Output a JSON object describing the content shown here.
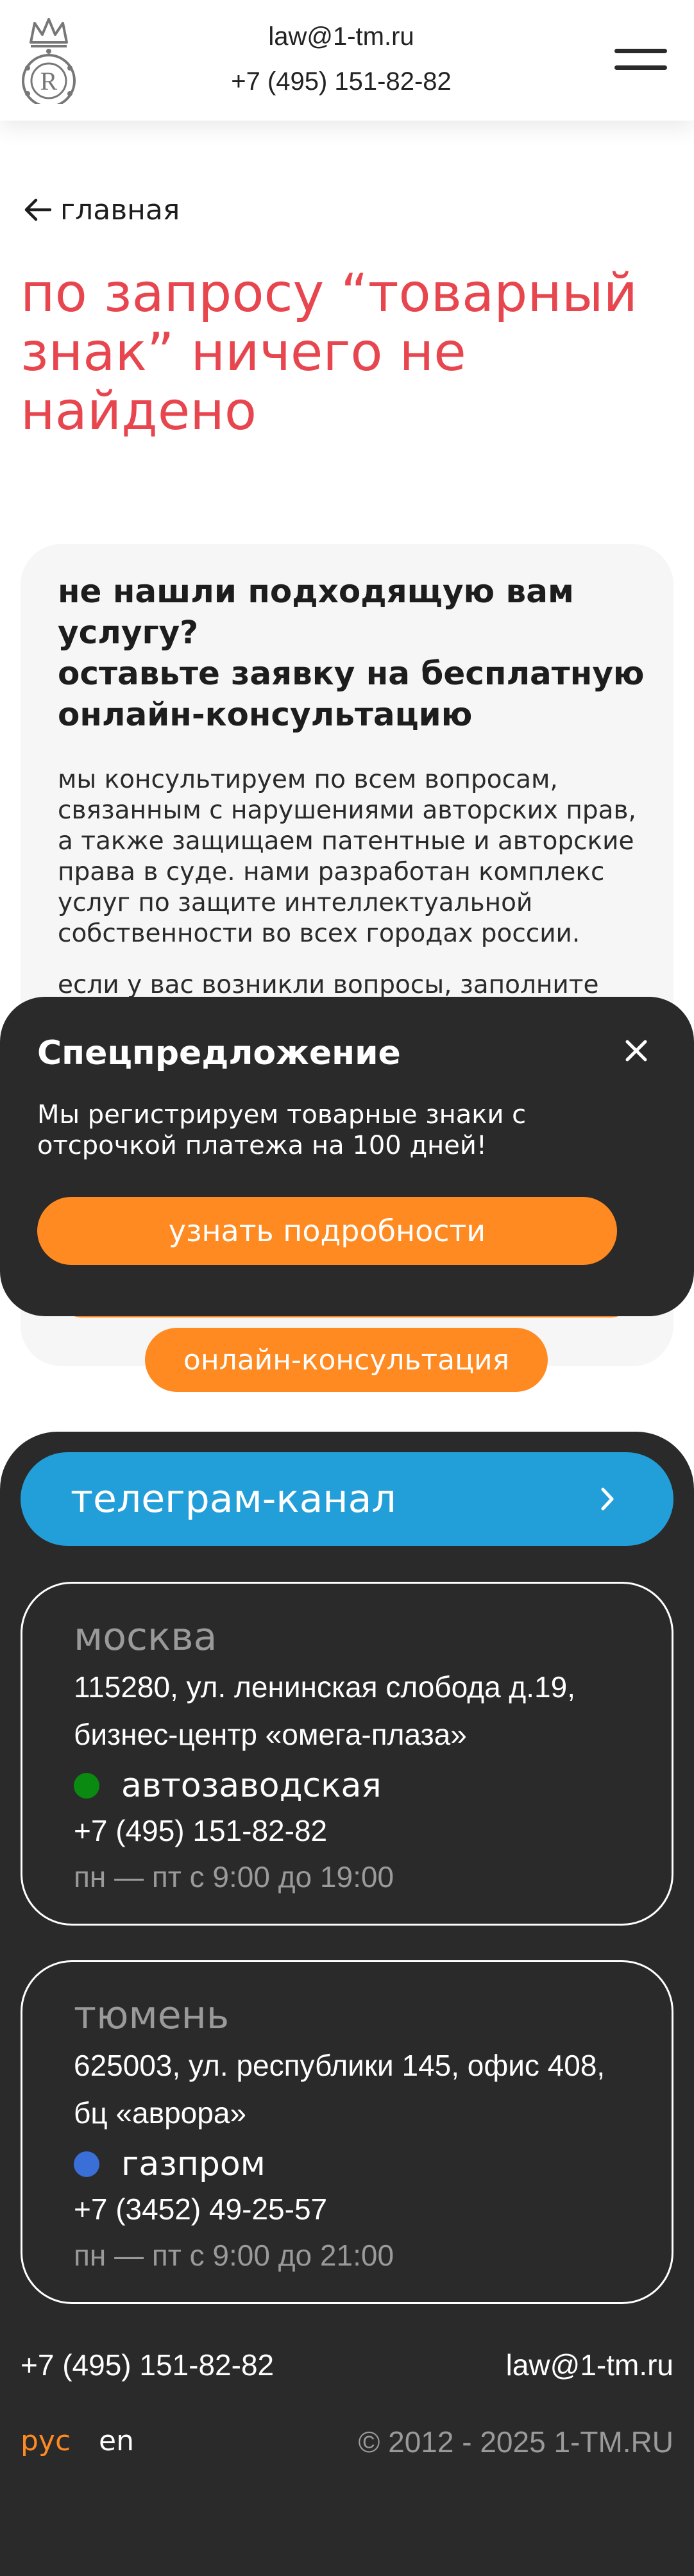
{
  "header": {
    "email": "law@1-tm.ru",
    "phone": "+7 (495) 151-82-82",
    "logo_letter": "R"
  },
  "breadcrumb": {
    "back_label": "главная"
  },
  "page_title": "по запросу “товарный знак” ничего не найдено",
  "consult": {
    "heading": "не нашли подходящую вам услугу?\nоставьте заявку на бесплатную онлайн-консультацию",
    "paragraph1": "мы консультируем по всем вопросам, связанным с нарушениями авторских прав, а также защищаем патентные и авторские права в суде. нами разработан комплекс услуг по защите интеллектуальной собственности во всех городах россии.",
    "paragraph2": "если у вас возникли вопросы, заполните",
    "button_label": "онлайн-консультация"
  },
  "popup": {
    "title": "Спецпредложение",
    "text": "Мы регистрируем товарные знаки с отсрочкой платежа на 100 дней!",
    "button_label": "узнать подробности"
  },
  "footer": {
    "telegram_label": "телеграм-канал",
    "offices": [
      {
        "city": "москва",
        "address": "115280, ул. ленинская слобода д.19, бизнес-центр «омега-плаза»",
        "metro": "автозаводская",
        "metro_color": "#0a8a10",
        "phone": "+7 (495) 151-82-82",
        "hours": "пн — пт с 9:00 до 19:00"
      },
      {
        "city": "тюмень",
        "address": "625003, ул. республики 145, офис 408, бц «аврора»",
        "metro": "газпром",
        "metro_color": "#3a6fd8",
        "phone": "+7 (3452) 49-25-57",
        "hours": "пн — пт с 9:00 до 21:00"
      }
    ],
    "phone": "+7 (495) 151-82-82",
    "email": "law@1-tm.ru",
    "lang_ru": "рус",
    "lang_en": "en",
    "copyright": "© 2012 - 2025 1-TM.RU"
  },
  "colors": {
    "accent": "#e8464e",
    "orange": "#ff8a21",
    "dark": "#2a2a2a",
    "telegram": "#229ed9"
  }
}
